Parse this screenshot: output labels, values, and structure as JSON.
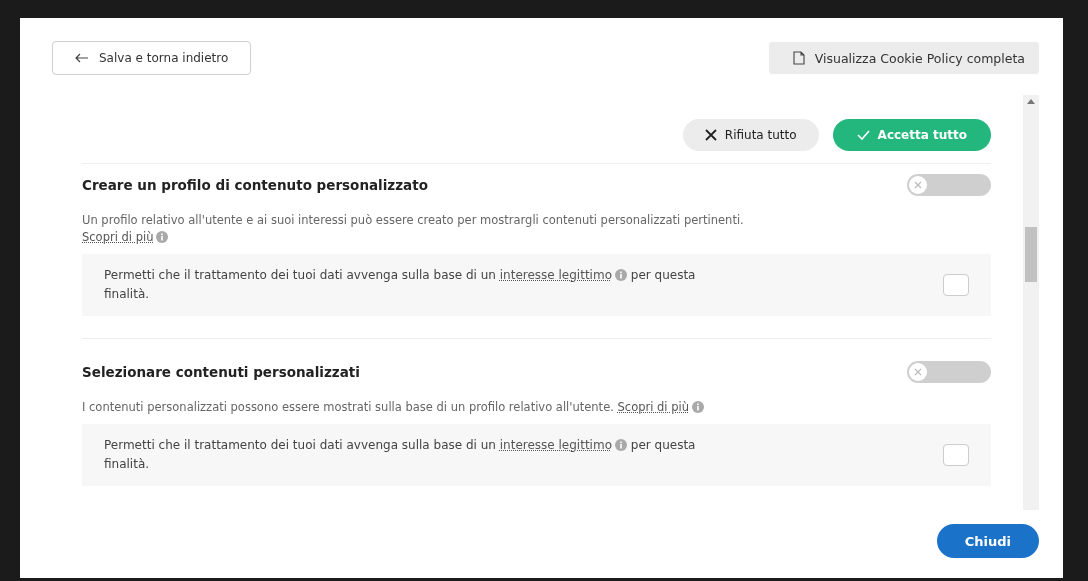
{
  "header": {
    "back_button": "Salva e torna indietro",
    "policy_button": "Visualizza Cookie Policy completa"
  },
  "actions": {
    "reject": "Rifiuta tutto",
    "accept": "Accetta tutto"
  },
  "purposes": [
    {
      "title": "Creare un profilo di contenuto personalizzato",
      "on": false,
      "description": "Un profilo relativo all'utente e ai suoi interessi può essere creato per mostrargli contenuti personalizzati pertinenti.",
      "learn_more": "Scopri di più",
      "consent": {
        "text_before": "Permetti che il trattamento dei tuoi dati avvenga sulla base di un",
        "link": "interesse legittimo",
        "text_after": "per questa finalità.",
        "checked": false
      }
    },
    {
      "title": "Selezionare contenuti personalizzati",
      "on": false,
      "description": "I contenuti personalizzati possono essere mostrati sulla base di un profilo relativo all'utente.",
      "learn_more": "Scopri di più",
      "consent": {
        "text_before": "Permetti che il trattamento dei tuoi dati avvenga sulla base di un",
        "link": "interesse legittimo",
        "text_after": "per questa finalità.",
        "checked": false
      }
    }
  ],
  "close_button": "Chiudi"
}
